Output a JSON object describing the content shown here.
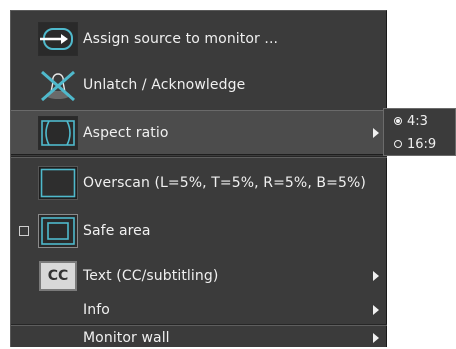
{
  "menu": {
    "items": [
      {
        "label": "Assign source to monitor ...",
        "icon": "assign-source-icon",
        "has_submenu": false
      },
      {
        "label": "Unlatch / Acknowledge",
        "icon": "unlatch-icon",
        "has_submenu": false
      },
      {
        "label": "Aspect ratio",
        "icon": "aspect-ratio-icon",
        "has_submenu": true
      },
      {
        "label": "Overscan (L=5%, T=5%, R=5%, B=5%)",
        "icon": "overscan-icon",
        "has_submenu": false
      },
      {
        "label": "Safe area",
        "icon": "safe-area-icon",
        "has_submenu": false,
        "checked": false
      },
      {
        "label": "Text (CC/subtitling)",
        "icon": "cc-icon",
        "icon_text": "CC",
        "has_submenu": true
      },
      {
        "label": "Info",
        "has_submenu": true
      },
      {
        "label": "Monitor wall",
        "has_submenu": true
      }
    ]
  },
  "submenu": {
    "options": [
      {
        "label": "4:3",
        "selected": true
      },
      {
        "label": "16:9",
        "selected": false
      }
    ]
  },
  "colors": {
    "menu_bg": "#3b3b3b",
    "highlight_bg": "#4c4c4c",
    "icon_accent": "#4fb9cc",
    "text": "#f0f0f0"
  }
}
